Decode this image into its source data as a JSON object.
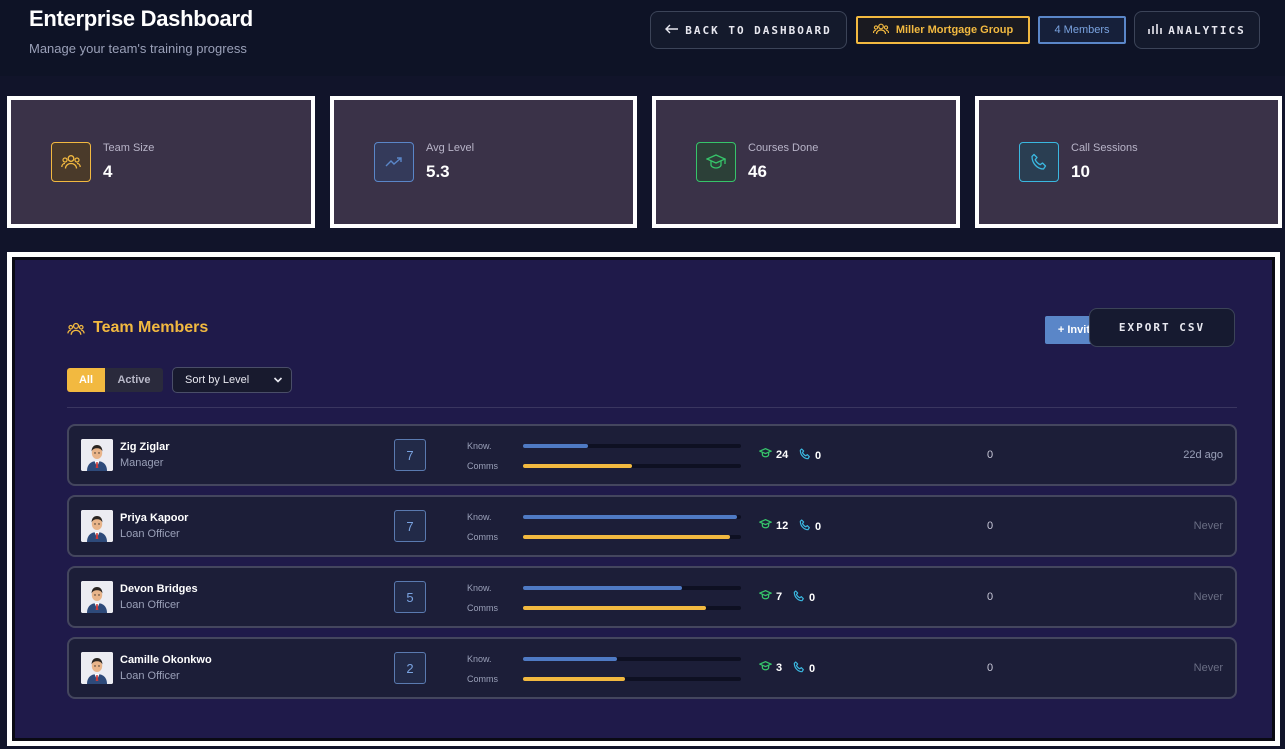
{
  "header": {
    "title": "Enterprise Dashboard",
    "subtitle": "Manage your team's training progress",
    "back_label": "BACK TO DASHBOARD",
    "org_name": "Miller Mortgage Group",
    "members_count": "4 Members",
    "analytics_label": "ANALYTICS"
  },
  "stats": [
    {
      "label": "Team Size",
      "value": "4",
      "icon": "users-icon",
      "color": "#f2b940"
    },
    {
      "label": "Avg Level",
      "value": "5.3",
      "icon": "trending-up-icon",
      "color": "#5a86c8"
    },
    {
      "label": "Courses Done",
      "value": "46",
      "icon": "graduation-cap-icon",
      "color": "#36c46a"
    },
    {
      "label": "Call Sessions",
      "value": "10",
      "icon": "phone-icon",
      "color": "#3ab8e0"
    }
  ],
  "team": {
    "title": "Team Members",
    "invite_label": "+ Invite",
    "export_label": "EXPORT CSV",
    "filter_all": "All",
    "filter_active": "Active",
    "sort_label": "Sort by Level",
    "know_label": "Know.",
    "comms_label": "Comms",
    "members": [
      {
        "name": "Zig Ziglar",
        "role": "Manager",
        "level": "7",
        "knowledge": 0.3,
        "comms": 0.5,
        "courses": "24",
        "calls": "0",
        "score": "0",
        "last_active": "22d ago"
      },
      {
        "name": "Priya Kapoor",
        "role": "Loan Officer",
        "level": "7",
        "knowledge": 0.98,
        "comms": 0.95,
        "courses": "12",
        "calls": "0",
        "score": "0",
        "last_active": "Never"
      },
      {
        "name": "Devon Bridges",
        "role": "Loan Officer",
        "level": "5",
        "knowledge": 0.73,
        "comms": 0.84,
        "courses": "7",
        "calls": "0",
        "score": "0",
        "last_active": "Never"
      },
      {
        "name": "Camille Okonkwo",
        "role": "Loan Officer",
        "level": "2",
        "knowledge": 0.43,
        "comms": 0.47,
        "courses": "3",
        "calls": "0",
        "score": "0",
        "last_active": "Never"
      }
    ]
  },
  "colors": {
    "accent": "#f2b940",
    "blue": "#5a86c8",
    "knowledge_bar": "#4f7ac4",
    "comms_bar": "#f2b940",
    "course_icon": "#36c46a",
    "call_icon": "#3ab8e0"
  }
}
